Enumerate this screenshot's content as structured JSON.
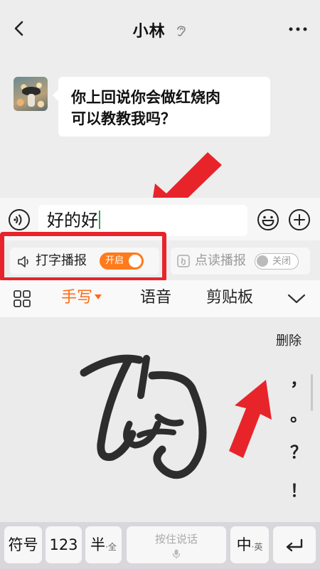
{
  "header": {
    "title": "小林",
    "back_icon": "back-chevron-icon",
    "mode_icon": "ear-icon",
    "more_icon": "more-dots-icon"
  },
  "chat": {
    "messages": [
      {
        "sender": "contact",
        "text": "你上回说你会做红烧肉\n可以教教我吗？"
      }
    ]
  },
  "input": {
    "value": "好的好",
    "caret_color": "#2ea44f"
  },
  "broadcast": {
    "typing_label": "打字播报",
    "typing_toggle": "开启",
    "reading_label": "点读播报",
    "reading_toggle": "关闭"
  },
  "keyboard": {
    "toolbar": {
      "tabs": [
        "手写",
        "语音",
        "剪贴板"
      ],
      "active_tab": "手写"
    },
    "side": {
      "delete_label": "删除",
      "punctuation": [
        "，",
        "。",
        "？",
        "！"
      ]
    },
    "bottom_keys": {
      "symbols": "符号",
      "numbers": "123",
      "half_width": "半",
      "half_width_sub": "·全",
      "voice_input": "按住说话",
      "lang": "中",
      "lang_sub": "·英"
    }
  },
  "colors": {
    "accent": "#ff6a13",
    "annotation_red": "#e8242b",
    "toggle_on": "#ff7a1a"
  }
}
